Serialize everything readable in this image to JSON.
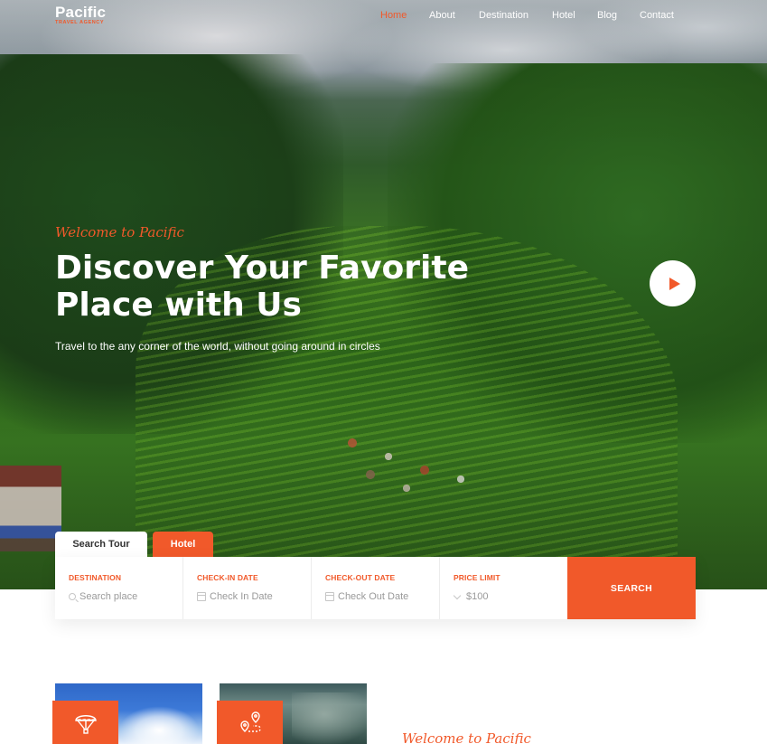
{
  "brand": {
    "name": "Pacific",
    "tagline": "TRAVEL AGENCY",
    "accent_color": "#f1592a"
  },
  "nav": {
    "items": [
      {
        "label": "Home",
        "active": true
      },
      {
        "label": "About",
        "active": false
      },
      {
        "label": "Destination",
        "active": false
      },
      {
        "label": "Hotel",
        "active": false
      },
      {
        "label": "Blog",
        "active": false
      },
      {
        "label": "Contact",
        "active": false
      }
    ]
  },
  "hero": {
    "welcome": "Welcome to Pacific",
    "title_line1": "Discover Your Favorite",
    "title_line2": "Place with Us",
    "subtitle": "Travel to the any corner of the world, without going around in circles",
    "play_icon": "play-icon"
  },
  "search": {
    "tabs": [
      {
        "label": "Search Tour",
        "active": true
      },
      {
        "label": "Hotel",
        "active": false
      }
    ],
    "fields": [
      {
        "label": "DESTINATION",
        "placeholder": "Search place",
        "icon": "search-icon"
      },
      {
        "label": "CHECK-IN DATE",
        "placeholder": "Check In Date",
        "icon": "calendar-icon"
      },
      {
        "label": "CHECK-OUT DATE",
        "placeholder": "Check Out Date",
        "icon": "calendar-icon"
      },
      {
        "label": "PRICE LIMIT",
        "value": "$100",
        "icon": "chevron-down-icon"
      }
    ],
    "button_label": "SEARCH"
  },
  "services": {
    "cards": [
      {
        "icon": "parachute-icon"
      },
      {
        "icon": "route-map-icon"
      }
    ],
    "welcome": "Welcome to Pacific"
  }
}
